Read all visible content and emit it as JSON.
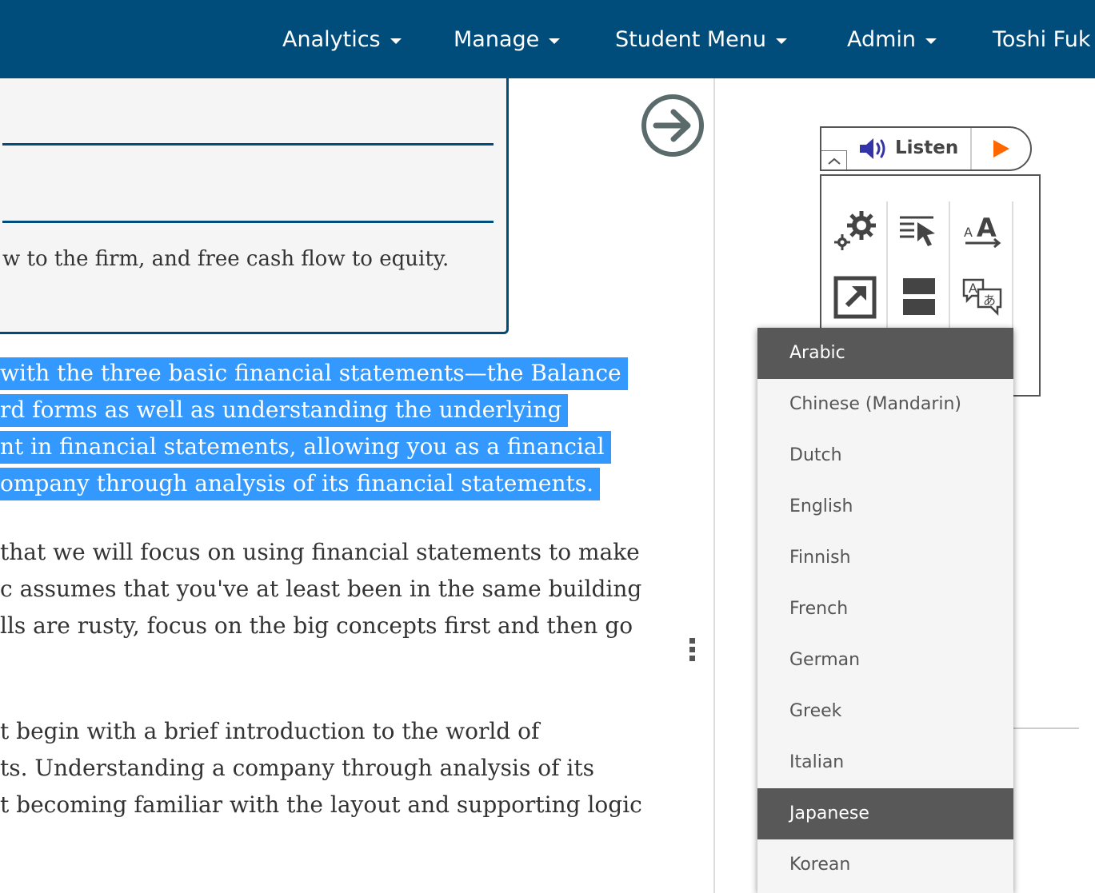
{
  "nav": {
    "items": [
      {
        "label": "Analytics"
      },
      {
        "label": "Manage"
      },
      {
        "label": "Student Menu"
      },
      {
        "label": "Admin"
      },
      {
        "label": "Toshi Fuk"
      }
    ]
  },
  "content": {
    "objective_text": "w to the firm, and free cash flow to equity.",
    "highlighted_paragraph": [
      "with the three basic financial statements—the Balance",
      "rd forms as well as understanding the underlying",
      "nt in financial statements, allowing you as a financial",
      "ompany through analysis of its financial statements."
    ],
    "paragraph_2": [
      "that we will focus on using financial statements to make",
      "c assumes that you've at least been in the same building",
      "lls are rusty, focus on the big concepts first and then go"
    ],
    "paragraph_3": [
      "t begin with a brief introduction to the world of",
      "ts. Understanding a company through analysis of its",
      "t becoming familiar with the layout and supporting logic"
    ],
    "highlight_color": "#3399ff"
  },
  "toolbar": {
    "listen_label": "Listen",
    "play_color": "#ff6600",
    "speaker_color": "#3333aa",
    "tools": [
      {
        "icon": "settings-gears-icon"
      },
      {
        "icon": "click-to-speak-icon"
      },
      {
        "icon": "text-size-icon"
      },
      {
        "icon": "popout-icon"
      },
      {
        "icon": "screen-mask-icon"
      },
      {
        "icon": "translate-icon"
      }
    ]
  },
  "language_menu": {
    "items": [
      {
        "label": "Arabic",
        "style": "dark"
      },
      {
        "label": "Chinese (Mandarin)",
        "style": "light"
      },
      {
        "label": "Dutch",
        "style": "light"
      },
      {
        "label": "English",
        "style": "light"
      },
      {
        "label": "Finnish",
        "style": "light"
      },
      {
        "label": "French",
        "style": "light"
      },
      {
        "label": "German",
        "style": "light"
      },
      {
        "label": "Greek",
        "style": "light"
      },
      {
        "label": "Italian",
        "style": "light"
      },
      {
        "label": "Japanese",
        "style": "dark"
      },
      {
        "label": "Korean",
        "style": "light"
      }
    ]
  },
  "colors": {
    "nav_bg": "#004d7c",
    "accent": "#004d7c"
  }
}
